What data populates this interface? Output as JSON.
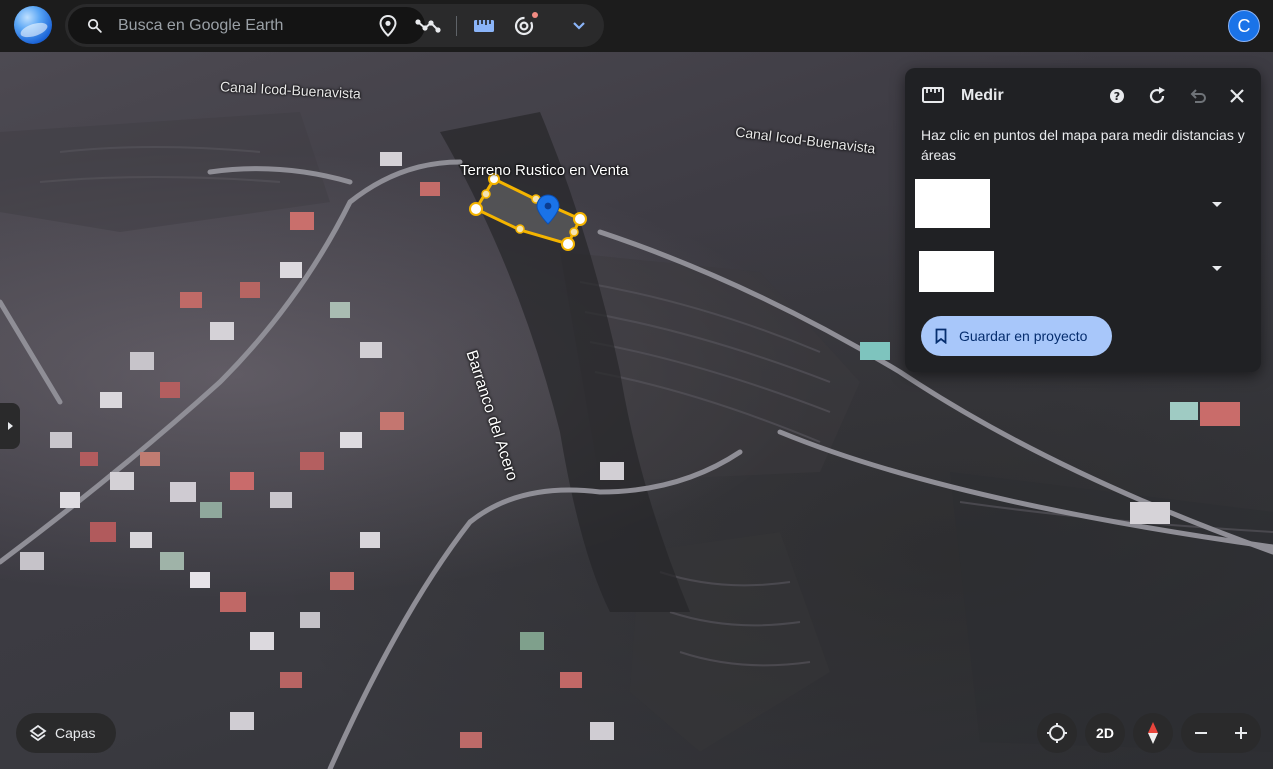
{
  "app": {
    "name": "Google Earth",
    "avatar_letter": "C"
  },
  "search": {
    "placeholder": "Busca en Google Earth",
    "value": ""
  },
  "toolbar": {
    "icons": [
      "place-marker-icon",
      "path-icon",
      "ruler-icon",
      "voyager-icon",
      "chevron-down-icon"
    ]
  },
  "map": {
    "labels": {
      "canal_1": "Canal Icod-Buenavista",
      "canal_2": "Canal Icod-Buenavista",
      "terreno": "Terreno Rustico en Venta",
      "barranco": "Barranco del Acero"
    },
    "polygon_color": "#f4b400",
    "pin_color": "#1a73e8"
  },
  "measure_panel": {
    "title": "Medir",
    "description": "Haz clic en puntos del mapa para medir distancias y áreas",
    "save_label": "Guardar en proyecto"
  },
  "controls": {
    "layers_label": "Capas",
    "view_mode_label": "2D"
  },
  "colors": {
    "accent": "#a8c7fa",
    "panel_bg": "#202124",
    "topbar_bg": "#1c1c1c"
  }
}
